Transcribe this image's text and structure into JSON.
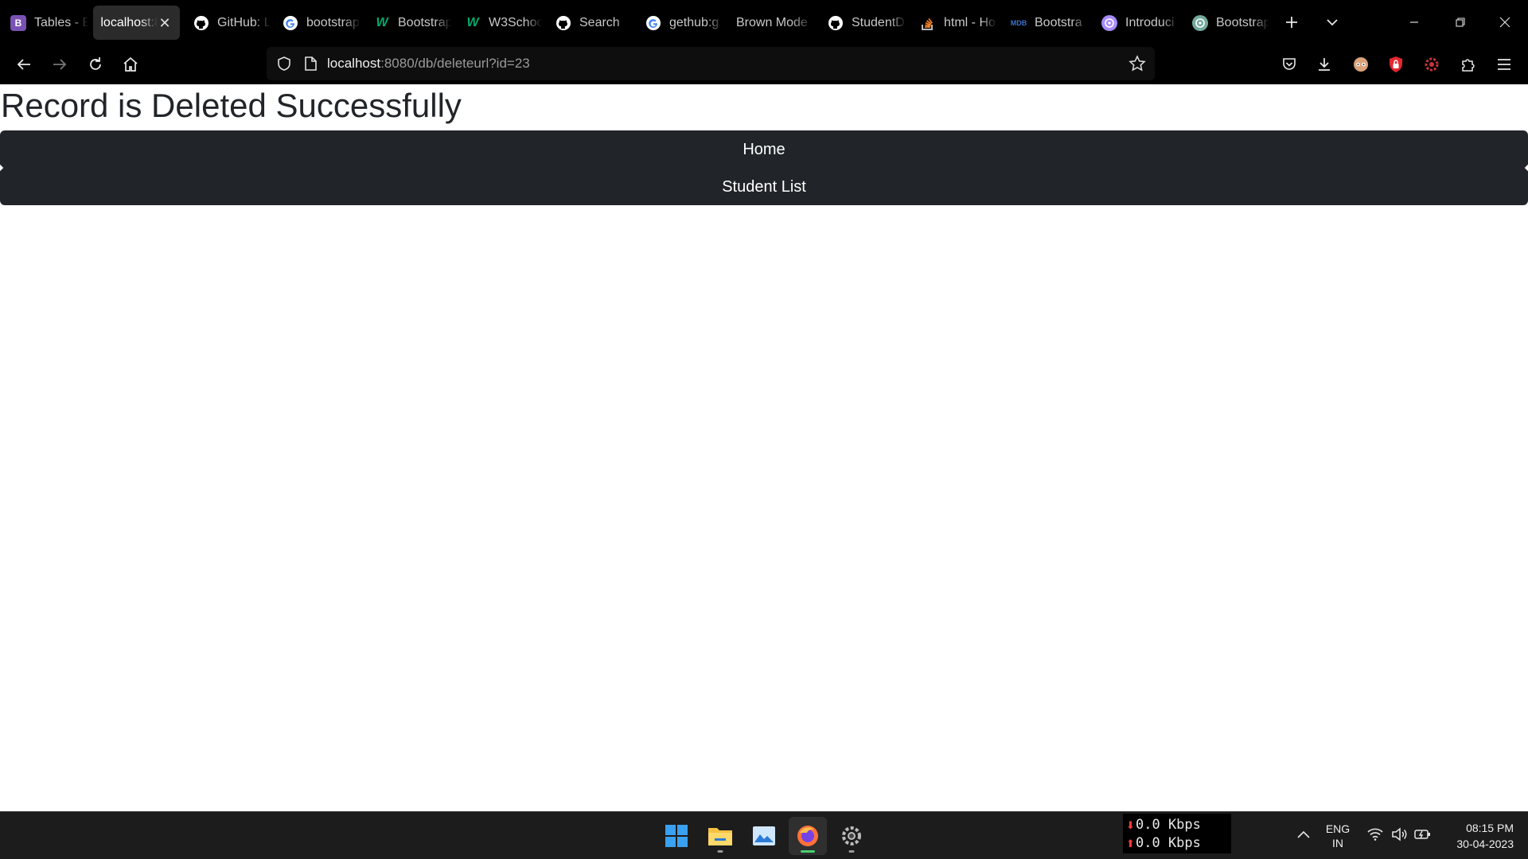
{
  "browser": {
    "tabs": [
      {
        "title": "Tables - B",
        "icon": "bootstrap-icon",
        "color": "#7952b3",
        "glyph": "B",
        "active": false
      },
      {
        "title": "localhost:8",
        "icon": "none",
        "color": "",
        "glyph": "",
        "active": true
      },
      {
        "title": "GitHub: L",
        "icon": "github-icon",
        "color": "#ffffff",
        "glyph": "",
        "active": false
      },
      {
        "title": "bootstrap",
        "icon": "google-icon",
        "color": "#4285f4",
        "glyph": "G",
        "active": false
      },
      {
        "title": "Bootstrap",
        "icon": "w3schools-icon",
        "color": "#04aa6d",
        "glyph": "W",
        "active": false
      },
      {
        "title": "W3Schoo",
        "icon": "w3schools-icon",
        "color": "#04aa6d",
        "glyph": "W",
        "active": false
      },
      {
        "title": "Search",
        "icon": "github-icon",
        "color": "#ffffff",
        "glyph": "",
        "active": false
      },
      {
        "title": "gethub:g",
        "icon": "google-icon",
        "color": "#4285f4",
        "glyph": "G",
        "active": false
      },
      {
        "title": "Brown Mode",
        "icon": "none",
        "color": "",
        "glyph": "",
        "active": false
      },
      {
        "title": "StudentD",
        "icon": "github-icon",
        "color": "#ffffff",
        "glyph": "",
        "active": false
      },
      {
        "title": "html - Ho",
        "icon": "stackoverflow-icon",
        "color": "#f48024",
        "glyph": "",
        "active": false
      },
      {
        "title": "Bootstra",
        "icon": "mdb-icon",
        "color": "#3b71ca",
        "glyph": "MDB",
        "active": false
      },
      {
        "title": "Introduci",
        "icon": "openai-icon",
        "color": "#a78bfa",
        "glyph": "",
        "active": false
      },
      {
        "title": "Bootstrap",
        "icon": "chatgpt-icon",
        "color": "#74aa9c",
        "glyph": "",
        "active": false
      }
    ],
    "url": {
      "host": "localhost",
      "rest": ":8080/db/deleteurl?id=23"
    }
  },
  "page": {
    "heading": "Record is Deleted Successfully",
    "nav": {
      "home": "Home",
      "student_list": "Student List"
    }
  },
  "taskbar": {
    "net_down": "0.0 Kbps",
    "net_up": "0.0 Kbps",
    "lang_line1": "ENG",
    "lang_line2": "IN",
    "time": "08:15 PM",
    "date": "30-04-2023"
  }
}
